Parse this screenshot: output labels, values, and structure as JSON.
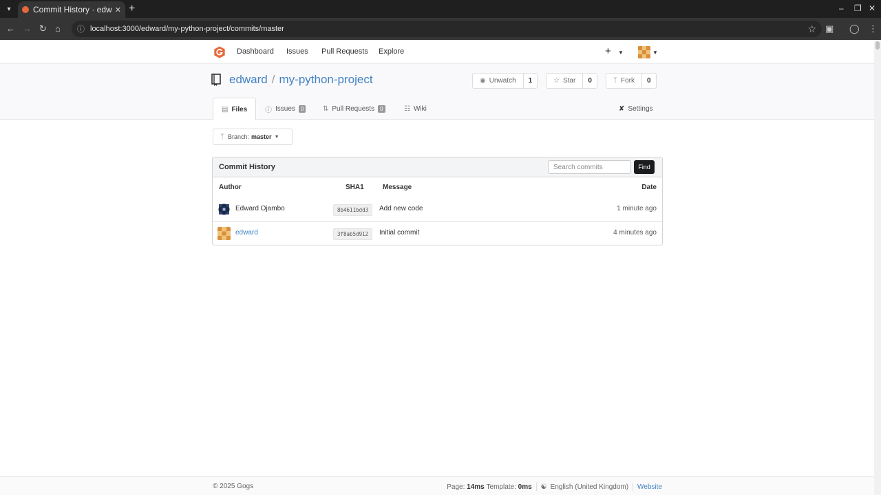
{
  "browser": {
    "tab_title": "Commit History · edward",
    "url": "localhost:3000/edward/my-python-project/commits/master"
  },
  "topnav": {
    "dashboard": "Dashboard",
    "issues": "Issues",
    "pull_requests": "Pull Requests",
    "explore": "Explore"
  },
  "repo": {
    "owner": "edward",
    "separator": "/",
    "name": "my-python-project",
    "unwatch_label": "Unwatch",
    "watch_count": "1",
    "star_label": "Star",
    "star_count": "0",
    "fork_label": "Fork",
    "fork_count": "0"
  },
  "tabs": {
    "files": "Files",
    "issues": "Issues",
    "issues_count": "0",
    "pull_requests": "Pull Requests",
    "pull_requests_count": "0",
    "wiki": "Wiki",
    "settings": "Settings"
  },
  "branch": {
    "label": "Branch:",
    "name": "master"
  },
  "commits": {
    "title": "Commit History",
    "search_placeholder": "Search commits",
    "find_label": "Find",
    "columns": {
      "author": "Author",
      "sha1": "SHA1",
      "message": "Message",
      "date": "Date"
    },
    "rows": [
      {
        "author": "Edward Ojambo",
        "sha": "8b4611bdd3",
        "message": "Add new code",
        "date": "1 minute ago"
      },
      {
        "author": "edward",
        "sha": "3f8ab5d912",
        "message": "Initial commit",
        "date": "4 minutes ago"
      }
    ]
  },
  "footer": {
    "copyright": "© 2025 Gogs",
    "page_label": "Page:",
    "page_time": "14ms",
    "template_label": "Template:",
    "template_time": "0ms",
    "language": "English (United Kingdom)",
    "website": "Website"
  },
  "colors": {
    "link": "#4183c4",
    "find_button": "#1b1c1d",
    "header_bg": "#f9f8fa",
    "gogs_logo": "#e6683c"
  }
}
